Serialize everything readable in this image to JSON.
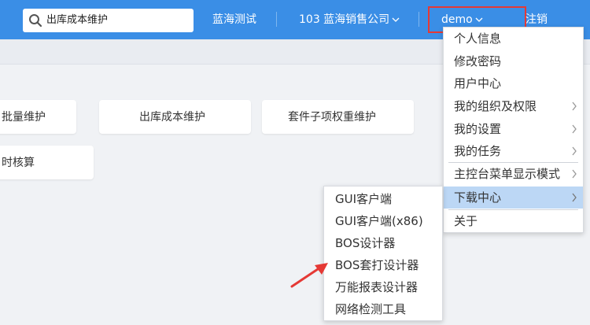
{
  "topbar": {
    "search_value": "出库成本维护",
    "search_icon": "search-icon",
    "env": "蓝海测试",
    "org": "103 蓝海销售公司",
    "user": "demo",
    "logout": "注销",
    "color": "#3a8ee6"
  },
  "cards": [
    {
      "label": "批量维护"
    },
    {
      "label": "出库成本维护"
    },
    {
      "label": "套件子项权重维护"
    },
    {
      "label": "时核算"
    }
  ],
  "user_menu": {
    "items": [
      {
        "label": "个人信息",
        "has_submenu": false
      },
      {
        "label": "修改密码",
        "has_submenu": false
      },
      {
        "label": "用户中心",
        "has_submenu": false
      },
      {
        "label": "我的组织及权限",
        "has_submenu": true
      },
      {
        "label": "我的设置",
        "has_submenu": true
      },
      {
        "label": "我的任务",
        "has_submenu": true
      },
      {
        "label": "主控台菜单显示模式",
        "has_submenu": true
      },
      {
        "label": "下载中心",
        "has_submenu": true,
        "active": true
      },
      {
        "label": "关于",
        "has_submenu": false
      }
    ],
    "highlight_color": "#bcd7f5"
  },
  "download_menu": {
    "items": [
      {
        "label": "GUI客户端"
      },
      {
        "label": "GUI客户端(x86)"
      },
      {
        "label": "BOS设计器"
      },
      {
        "label": "BOS套打设计器"
      },
      {
        "label": "万能报表设计器"
      },
      {
        "label": "网络检测工具"
      }
    ]
  },
  "annotation": {
    "arrow_color": "#e53935",
    "highlight_box_color": "#e53935"
  }
}
